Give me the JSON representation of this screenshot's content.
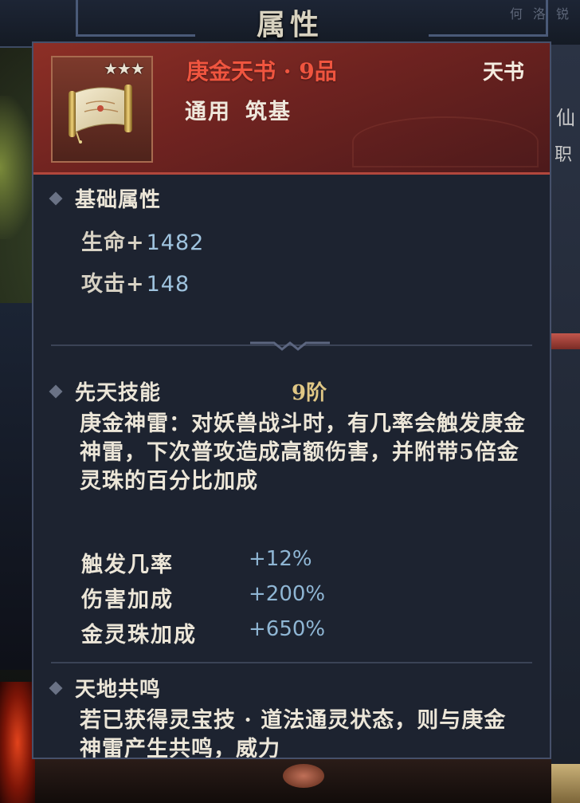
{
  "screen": {
    "title": "属性",
    "top_right_text": "何 洛 锐",
    "right_edge_chars": [
      "仙",
      "职"
    ]
  },
  "item": {
    "stars": "★★★",
    "name": "庚金天书 · 9品",
    "type": "天书",
    "tags": [
      "通用",
      "筑基"
    ],
    "icon": "scroll-icon"
  },
  "base_attributes": {
    "title": "基础属性",
    "stats": [
      {
        "label": "生命+",
        "value": "1482"
      },
      {
        "label": "攻击+",
        "value": "148"
      }
    ]
  },
  "innate_skill": {
    "title": "先天技能",
    "tier": "9阶",
    "description": "庚金神雷：对妖兽战斗时，有几率会触发庚金神雷，下次普攻造成高额伤害，并附带5倍金灵珠的百分比加成",
    "bonuses": [
      {
        "label": "触发几率",
        "value": "+12%"
      },
      {
        "label": "伤害加成",
        "value": "+200%"
      },
      {
        "label": "金灵珠加成",
        "value": "+650%"
      }
    ]
  },
  "resonance": {
    "title": "天地共鸣",
    "description": "若已获得灵宝技 · 道法通灵状态，则与庚金神雷产生共鸣，威力"
  },
  "colors": {
    "item_name": "#f0553f",
    "tier": "#e0c785",
    "stat_value": "#9fc3de",
    "header_bg": "#7d2a24",
    "panel_bg": "#1d2330"
  }
}
